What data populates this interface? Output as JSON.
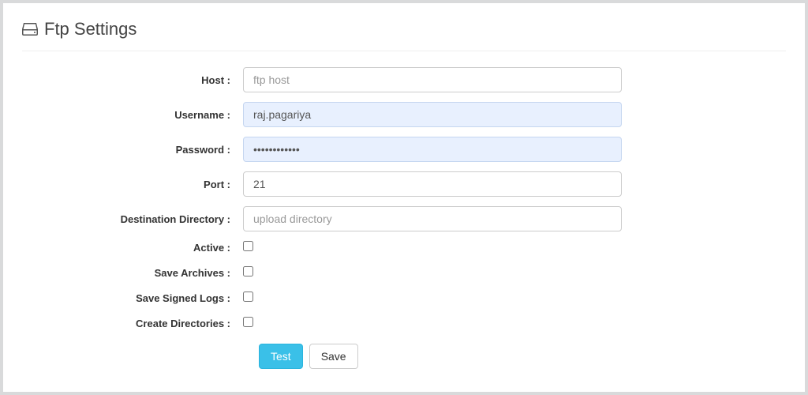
{
  "header": {
    "title": "Ftp Settings"
  },
  "form": {
    "host": {
      "label": "Host :",
      "placeholder": "ftp host",
      "value": ""
    },
    "username": {
      "label": "Username :",
      "value": "raj.pagariya"
    },
    "password": {
      "label": "Password :",
      "value": "••••••••••••"
    },
    "port": {
      "label": "Port :",
      "value": "21"
    },
    "destination": {
      "label": "Destination Directory :",
      "placeholder": "upload directory",
      "value": ""
    },
    "active": {
      "label": "Active :"
    },
    "save_archives": {
      "label": "Save Archives :"
    },
    "save_signed_logs": {
      "label": "Save Signed Logs :"
    },
    "create_directories": {
      "label": "Create Directories :"
    }
  },
  "buttons": {
    "test": "Test",
    "save": "Save"
  }
}
